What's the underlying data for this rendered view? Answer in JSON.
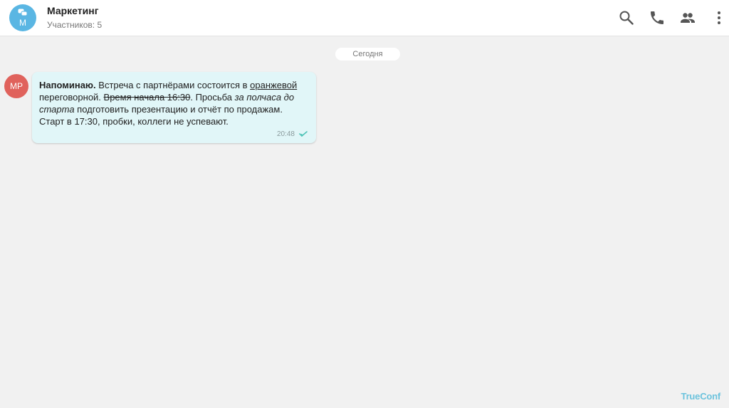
{
  "header": {
    "title": "Маркетинг",
    "subtitle": "Участников: 5",
    "avatar_letter": "M",
    "icons": [
      "search-icon",
      "phone-icon",
      "participants-icon",
      "more-vert-icon"
    ]
  },
  "chat": {
    "date_separator": "Сегодня",
    "messages": [
      {
        "avatar_initials": "MP",
        "segments": [
          {
            "text": "Напоминаю.",
            "style": "bold"
          },
          {
            "text": " Встреча с партнёрами состоится в ",
            "style": "normal"
          },
          {
            "text": "оранжевой",
            "style": "underline"
          },
          {
            "text": " переговорной. ",
            "style": "normal"
          },
          {
            "text": "Время начала 16:30",
            "style": "strikethrough"
          },
          {
            "text": ". Просьба ",
            "style": "normal"
          },
          {
            "text": "за полчаса до старта",
            "style": "italic"
          },
          {
            "text": " подготовить презентацию и отчёт по продажам. Старт в 17:30, пробки, коллеги не успевают.",
            "style": "normal"
          }
        ],
        "time": "20:48",
        "status_icon": "read-check-icon"
      }
    ]
  },
  "watermark": "TrueConf",
  "colors": {
    "chat_avatar": "#5ab6e3",
    "sender_avatar": "#e0625c",
    "bubble": "#e1f6f8",
    "background": "#f1f1f1",
    "header": "#ffffff",
    "watermark": "#6cc3dd",
    "check": "#4fc3b7"
  }
}
